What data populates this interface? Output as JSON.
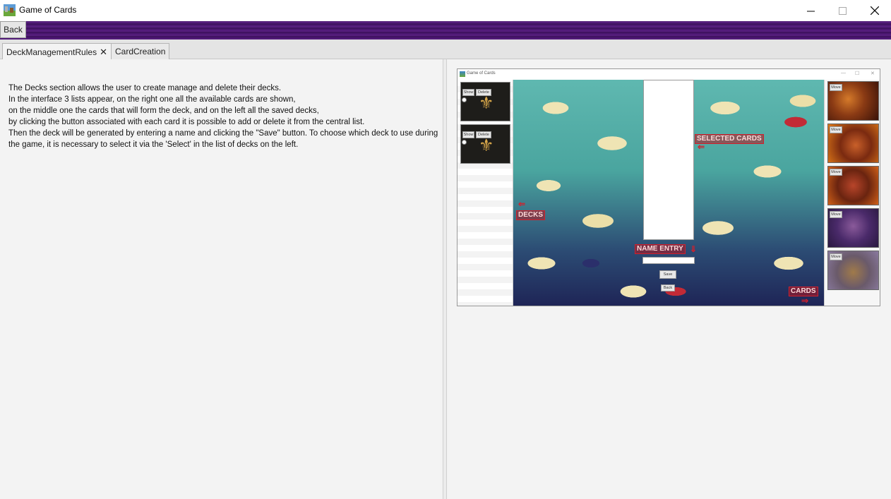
{
  "window": {
    "title": "Game of Cards",
    "controls": {
      "minimize": "—",
      "maximize": "☐",
      "close": "✕"
    }
  },
  "toolbar": {
    "back_label": "Back"
  },
  "tabs": [
    {
      "label": "DeckManagementRules",
      "close": "✕",
      "active": true
    },
    {
      "label": "CardCreation",
      "active": false
    }
  ],
  "rules": {
    "text": "The Decks section allows the user to create manage and delete their decks.\nIn the interface 3 lists appear, on the right one all the available cards are shown,\non the middle one the cards that will form the deck, and on the left all the saved decks,\nby clicking the button associated with each card it is possible to add or delete it from the central list.\nThen the deck will be generated by entering a name and clicking the \"Save\" button. To choose which deck to use during the game, it is necessary to select it via the 'Select' in the list of decks on the left."
  },
  "screenshot": {
    "title": "Game of Cards",
    "deck_buttons": {
      "show": "Show",
      "delete": "Delete"
    },
    "card_button": "Move",
    "save_button": "Save",
    "back_button": "Back",
    "annotations": {
      "decks": "DECKS",
      "selected_cards": "SELECTED CARDS",
      "name_entry": "NAME ENTRY",
      "cards": "CARDS"
    },
    "colors": {
      "annotation": "#d2202c",
      "toolbar": "#4b1670"
    }
  }
}
